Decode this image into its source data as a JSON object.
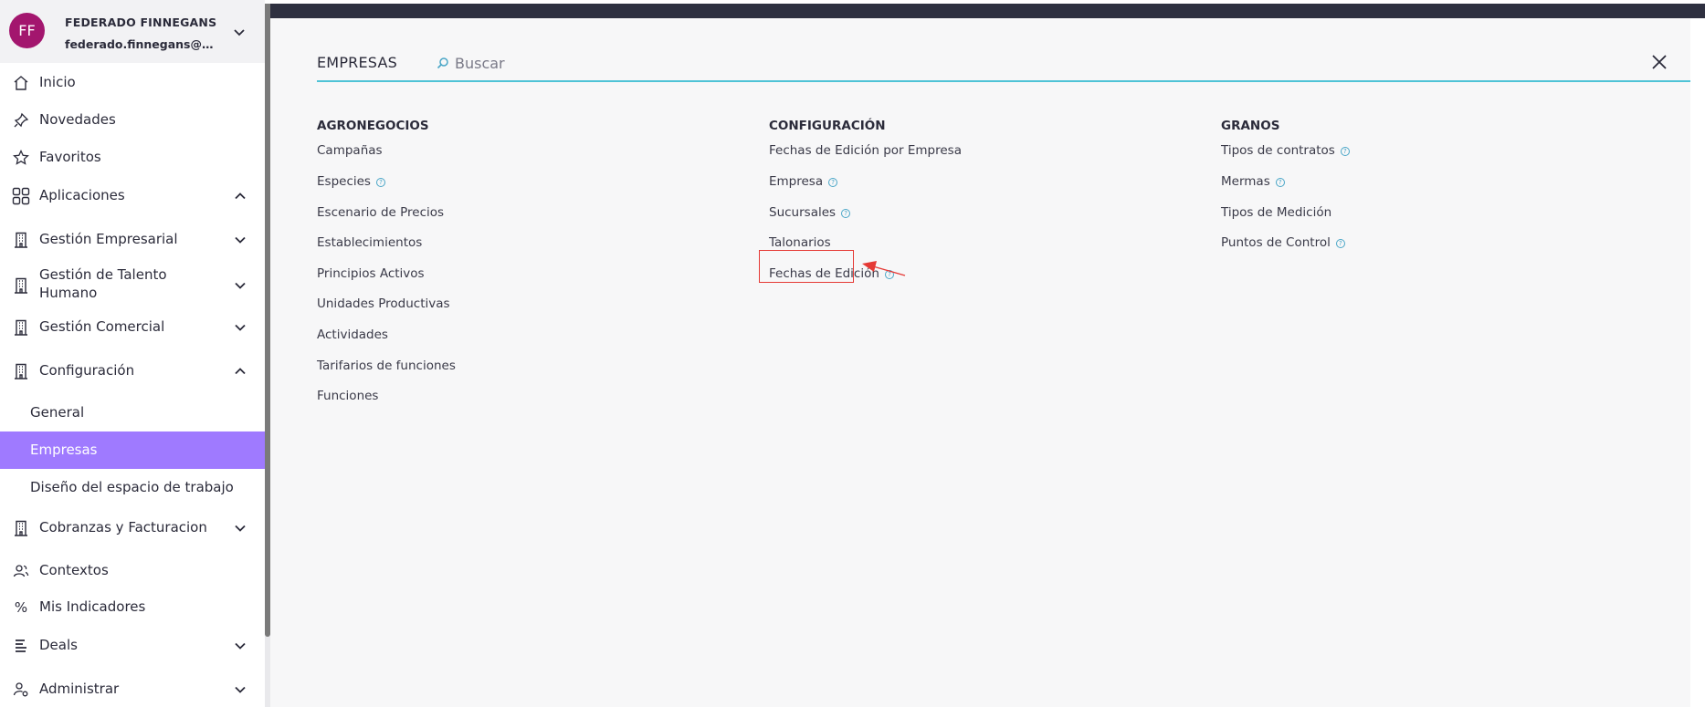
{
  "user": {
    "initials": "FF",
    "name": "FEDERADO FINNEGANS",
    "email": "federado.finnegans@fin..."
  },
  "sidebar": {
    "items": [
      {
        "label": "Inicio",
        "icon": "home-icon"
      },
      {
        "label": "Novedades",
        "icon": "pin-icon"
      },
      {
        "label": "Favoritos",
        "icon": "star-icon"
      },
      {
        "label": "Aplicaciones",
        "icon": "grid-icon",
        "expanded": true
      },
      {
        "label": "Gestión Empresarial",
        "icon": "building-icon"
      },
      {
        "label": "Gestión de Talento",
        "label2": "Humano",
        "icon": "building-icon"
      },
      {
        "label": "Gestión Comercial",
        "icon": "building-icon"
      },
      {
        "label": "Configuración",
        "icon": "building-icon",
        "expanded": true
      },
      {
        "label": "General"
      },
      {
        "label": "Empresas",
        "active": true
      },
      {
        "label": "Diseño del espacio de trabajo"
      },
      {
        "label": "Cobranzas y Facturacion",
        "icon": "building-icon"
      },
      {
        "label": "Contextos",
        "icon": "people-icon"
      },
      {
        "label": "Mis Indicadores",
        "icon": "percent-icon"
      },
      {
        "label": "Deals",
        "icon": "layers-icon"
      },
      {
        "label": "Administrar",
        "icon": "user-gear-icon"
      }
    ]
  },
  "panel": {
    "title": "EMPRESAS",
    "search_placeholder": "Buscar",
    "columns": [
      {
        "heading": "AGRONEGOCIOS",
        "links": [
          {
            "label": "Campañas"
          },
          {
            "label": "Especies",
            "help": true
          },
          {
            "label": "Escenario de Precios"
          },
          {
            "label": "Establecimientos"
          },
          {
            "label": "Principios Activos"
          },
          {
            "label": "Unidades Productivas"
          },
          {
            "label": "Actividades"
          },
          {
            "label": "Tarifarios de funciones"
          },
          {
            "label": "Funciones"
          }
        ]
      },
      {
        "heading": "CONFIGURACIÓN",
        "links": [
          {
            "label": "Fechas de Edición por Empresa"
          },
          {
            "label": "Empresa",
            "help": true
          },
          {
            "label": "Sucursales",
            "help": true
          },
          {
            "label": "Talonarios",
            "highlighted": true
          },
          {
            "label": "Fechas de Edición",
            "help": true
          }
        ]
      },
      {
        "heading": "GRANOS",
        "links": [
          {
            "label": "Tipos de contratos",
            "help": true
          },
          {
            "label": "Mermas",
            "help": true
          },
          {
            "label": "Tipos de Medición"
          },
          {
            "label": "Puntos de Control",
            "help": true
          }
        ]
      }
    ]
  },
  "colors": {
    "accent": "#9f7aff",
    "avatar": "#a3166e",
    "search_underline": "#4fc3d6",
    "annotation": "#e53935",
    "topbar": "#2e3040"
  }
}
